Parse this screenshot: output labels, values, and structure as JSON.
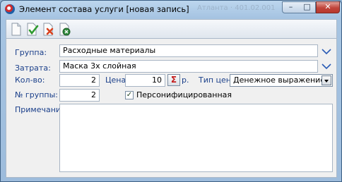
{
  "window": {
    "title": "Элемент состава услуги [новая запись]",
    "ghost_text": "Атланта · 401.02.001"
  },
  "titlebar_buttons": {
    "minimize": "–",
    "maximize": "□",
    "close": "✕"
  },
  "toolbar": [
    "new-icon",
    "save-check-icon",
    "cancel-icon",
    "close-record-icon"
  ],
  "form": {
    "group_label": "Группа:",
    "group_value": "Расходные материалы",
    "expense_label": "Затрата:",
    "expense_value": "Маска 3х слойная",
    "qty_label": "Кол-во:",
    "qty_value": "2",
    "price_label": "Цена:",
    "price_value": "10",
    "sigma_label": "Σ",
    "currency": "р.",
    "price_type_label": "Тип цены:",
    "price_type_value": "Денежное выражение",
    "group_no_label": "№ группы:",
    "group_no_value": "2",
    "personified_checked": true,
    "personified_label": "Персонифицированная",
    "note_label": "Примечание:",
    "note_value": ""
  },
  "colors": {
    "label_blue": "#1a3f8a",
    "chevron_blue": "#2a5bb5",
    "sigma_red": "#c41c1c"
  }
}
